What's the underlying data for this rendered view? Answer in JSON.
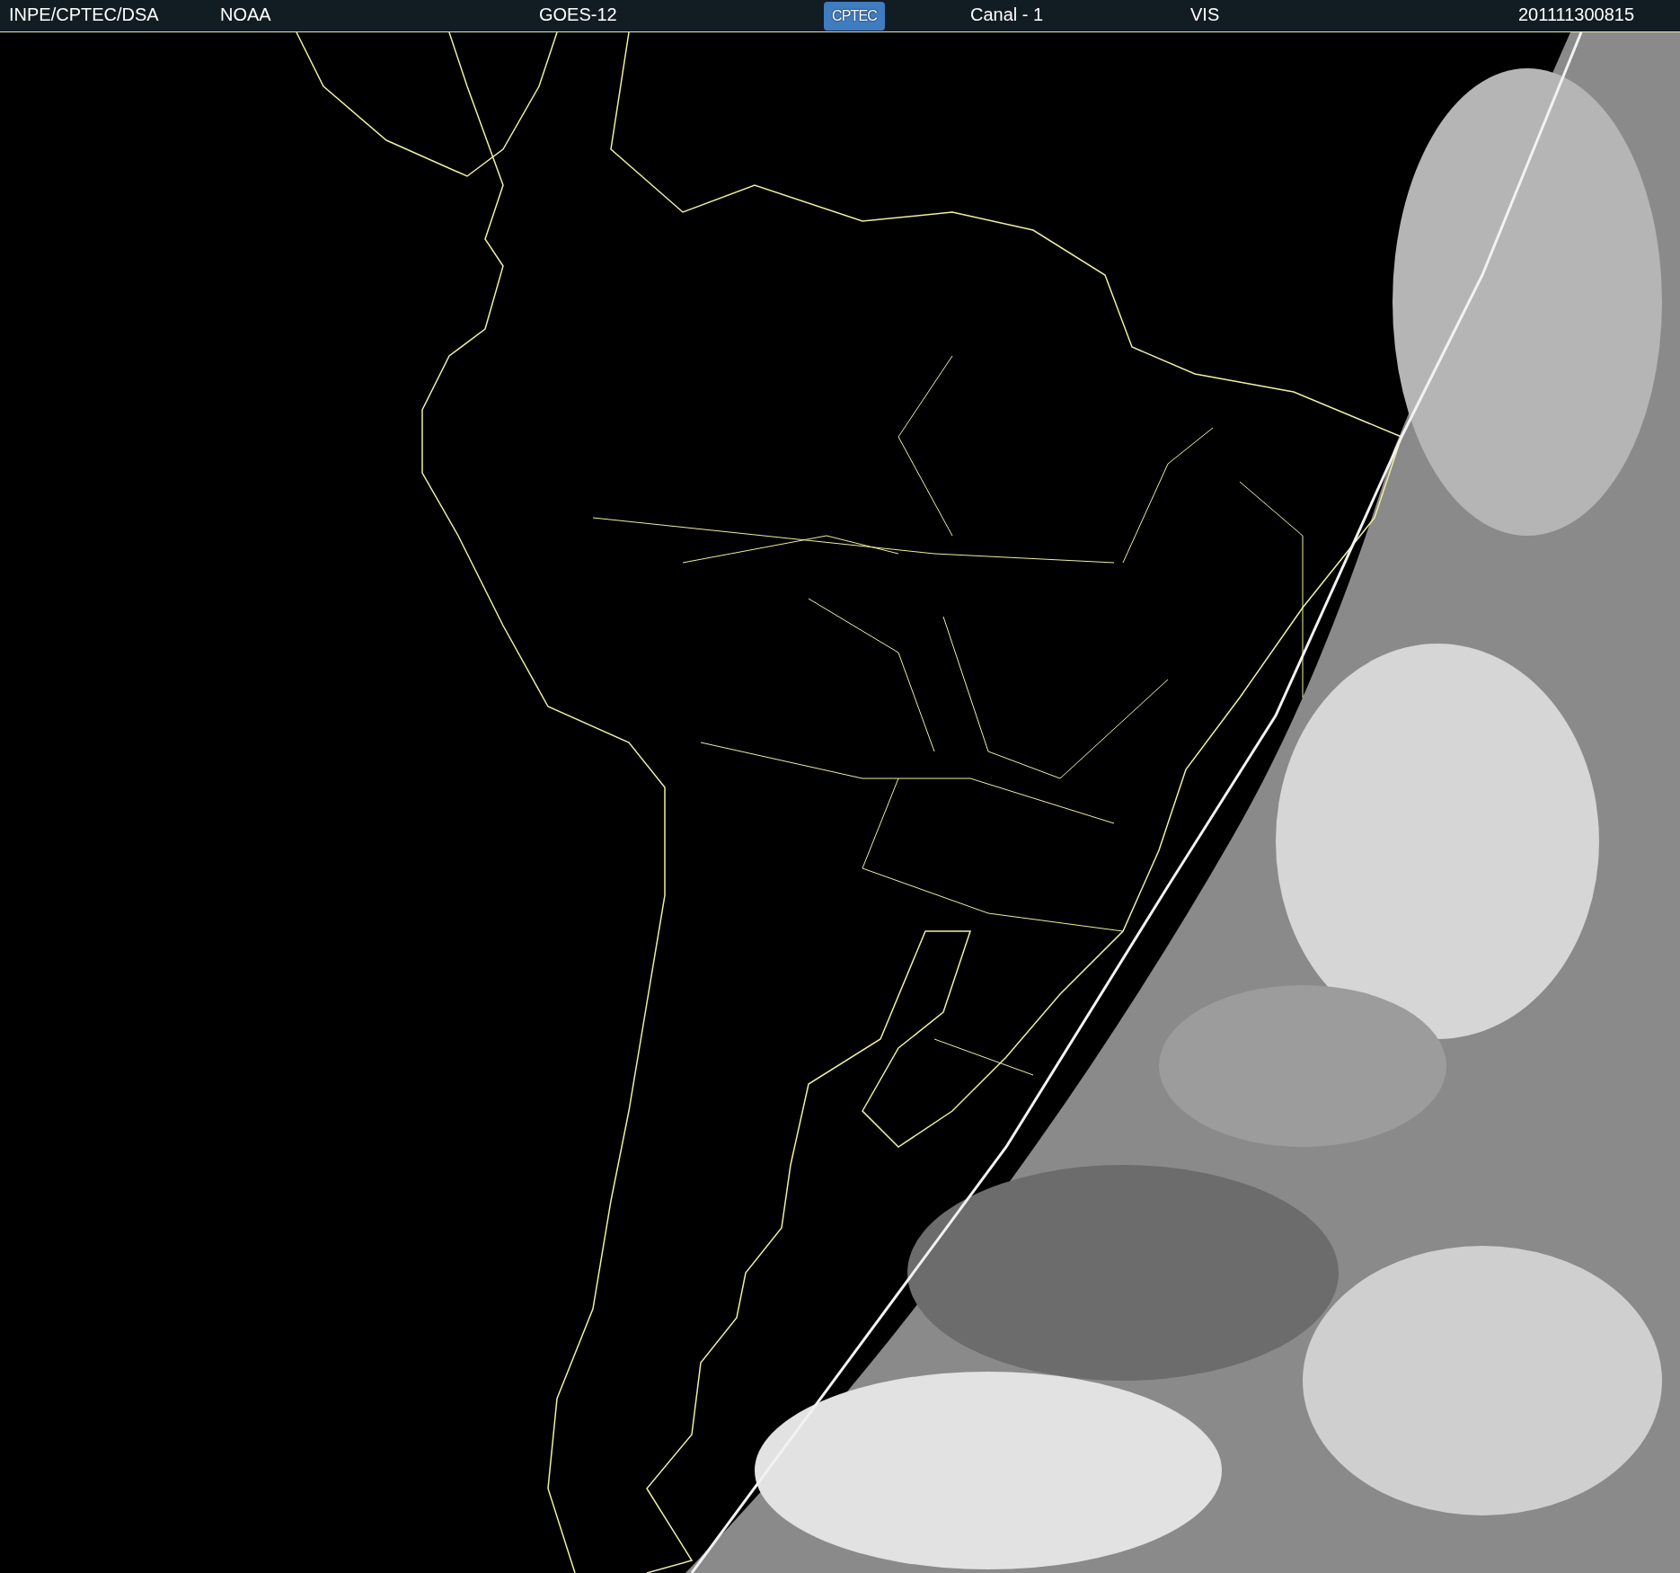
{
  "header": {
    "items": [
      {
        "kind": "text",
        "text": "INPE/CPTEC/DSA"
      },
      {
        "kind": "text",
        "text": "NOAA"
      },
      {
        "kind": "text",
        "text": "GOES-12"
      },
      {
        "kind": "logo",
        "text": "CPTEC"
      },
      {
        "kind": "text",
        "text": "Canal - 1"
      },
      {
        "kind": "text",
        "text": "VIS"
      },
      {
        "kind": "text",
        "text": "201111300815"
      }
    ]
  }
}
